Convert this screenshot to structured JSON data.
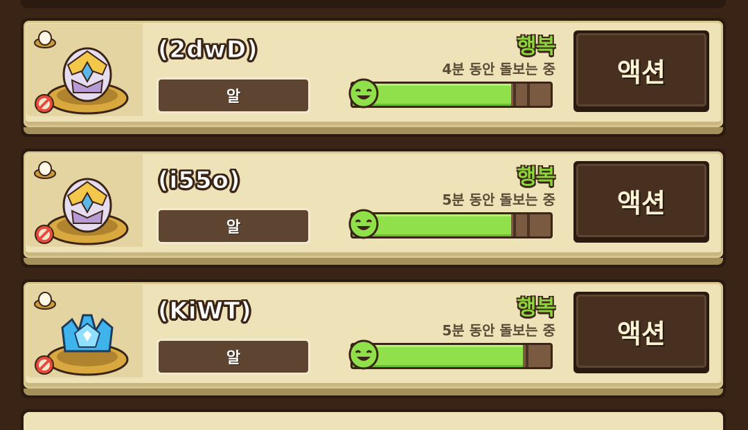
{
  "pets": [
    {
      "name": "(2dwD)",
      "stage": "알",
      "mood": "행복",
      "care_status": "4분 동안 돌보는 중",
      "happiness_level": 0.8,
      "segments": 2,
      "egg_type": "purple-crystal-egg",
      "action_label": "액션"
    },
    {
      "name": "(i55o)",
      "stage": "알",
      "mood": "행복",
      "care_status": "5분 동안 돌보는 중",
      "happiness_level": 0.8,
      "segments": 2,
      "egg_type": "purple-crystal-egg",
      "action_label": "액션"
    },
    {
      "name": "(KiWT)",
      "stage": "알",
      "mood": "행복",
      "care_status": "5분 동안 돌보는 중",
      "happiness_level": 0.86,
      "segments": 1,
      "egg_type": "blue-crystal-egg",
      "action_label": "액션"
    }
  ],
  "colors": {
    "mood_green": "#8bd43b",
    "bar_fill": "#8fe04a",
    "card_bg": "#ede2b8",
    "frame_dark": "#2a1a10"
  }
}
